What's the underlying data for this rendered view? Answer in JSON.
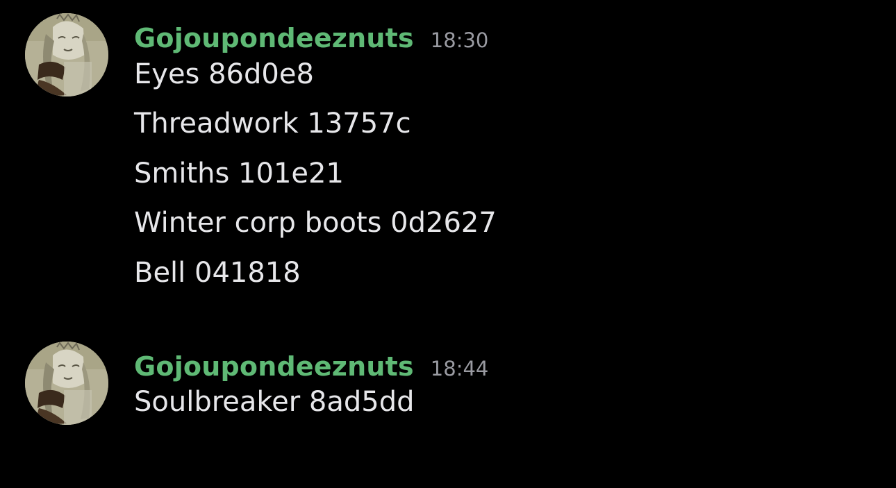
{
  "messages": [
    {
      "username": "Gojoupondeeznuts",
      "timestamp": "18:30",
      "lines": [
        "Eyes 86d0e8",
        "Threadwork 13757c",
        "Smiths 101e21",
        "Winter corp boots 0d2627",
        "Bell 041818"
      ]
    },
    {
      "username": "Gojoupondeeznuts",
      "timestamp": "18:44",
      "lines": [
        "Soulbreaker 8ad5dd"
      ]
    }
  ],
  "colors": {
    "background": "#000000",
    "username": "#5fb975",
    "timestamp": "#9a9ba2",
    "message_text": "#e7e7ea"
  }
}
